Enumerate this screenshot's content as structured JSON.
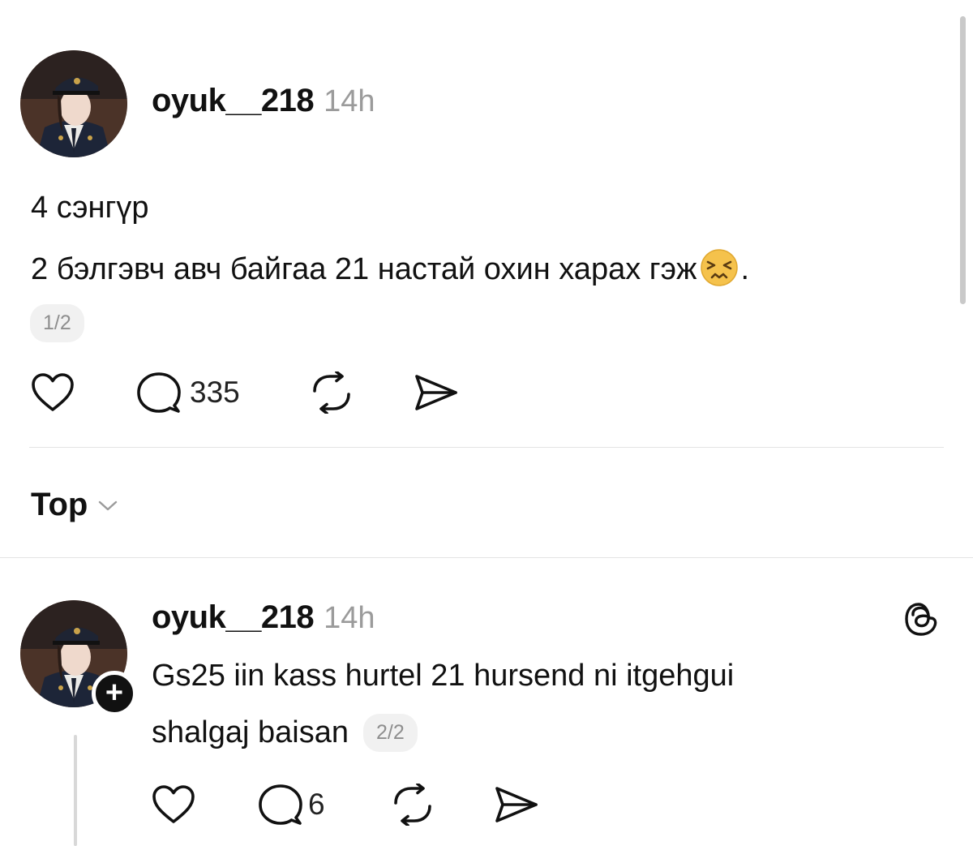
{
  "post": {
    "username": "oyuk__218",
    "time": "14h",
    "line1": "4 сэнгүр",
    "line2": "2 бэлгэвч авч байгаа 21 настай охин харах гэж",
    "line2_end": ".",
    "pager": "1/2",
    "reply_count": "335"
  },
  "sort": {
    "label": "Top"
  },
  "reply": {
    "username": "oyuk__218",
    "time": "14h",
    "line1": "Gs25 iin kass hurtel 21 hursend ni itgehgui",
    "line2": "shalgaj baisan",
    "pager": "2/2",
    "reply_count": "6"
  },
  "icons": {
    "avatar": "avatar-photo",
    "emoji": "persevering-face-emoji",
    "like": "heart-icon",
    "comment": "comment-bubble-icon",
    "repost": "repost-icon",
    "share": "send-icon",
    "threads_logo": "threads-logo-icon",
    "follow": "plus-icon",
    "sort_toggle": "chevron-down-icon"
  },
  "colors": {
    "text": "#111111",
    "muted": "#9b9b9b",
    "pill_bg": "#f1f1f1",
    "divider": "#e4e4e4",
    "emoji_face": "#f5c24c"
  }
}
